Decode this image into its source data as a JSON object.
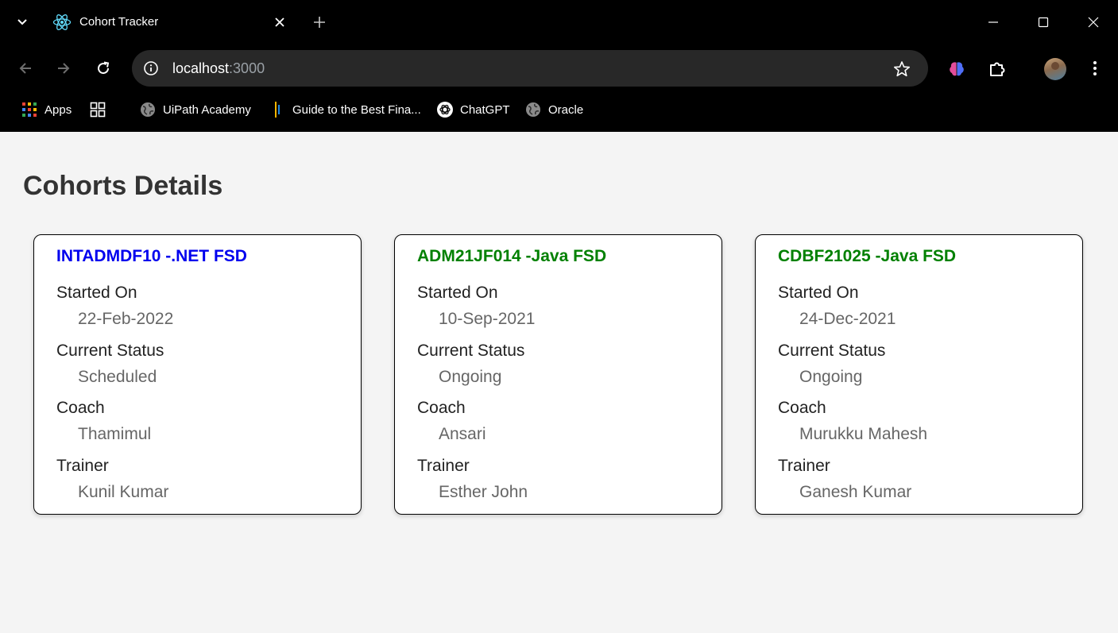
{
  "browser": {
    "tab": {
      "title": "Cohort Tracker",
      "favicon": "react-atom-icon"
    },
    "url": {
      "host": "localhost",
      "port": ":3000"
    },
    "bookmarks": [
      {
        "label": "Apps",
        "icon": "apps-grid-icon"
      },
      {
        "label": "",
        "icon": "tab-groups-icon"
      },
      {
        "label": "UiPath Academy",
        "icon": "globe-icon"
      },
      {
        "label": "Guide to the Best Fina...",
        "icon": "bars-icon"
      },
      {
        "label": "ChatGPT",
        "icon": "chatgpt-icon"
      },
      {
        "label": "Oracle",
        "icon": "globe-icon"
      }
    ]
  },
  "page": {
    "title": "Cohorts Details",
    "cohorts": [
      {
        "heading": "INTADMDF10 -.NET FSD",
        "heading_color": "#0000ee",
        "started_on_label": "Started On",
        "started_on": "22-Feb-2022",
        "status_label": "Current Status",
        "status": "Scheduled",
        "coach_label": "Coach",
        "coach": "Thamimul",
        "trainer_label": "Trainer",
        "trainer": "Kunil Kumar"
      },
      {
        "heading": "ADM21JF014 -Java FSD",
        "heading_color": "#008000",
        "started_on_label": "Started On",
        "started_on": "10-Sep-2021",
        "status_label": "Current Status",
        "status": "Ongoing",
        "coach_label": "Coach",
        "coach": "Ansari",
        "trainer_label": "Trainer",
        "trainer": "Esther John"
      },
      {
        "heading": "CDBF21025 -Java FSD",
        "heading_color": "#008000",
        "started_on_label": "Started On",
        "started_on": "24-Dec-2021",
        "status_label": "Current Status",
        "status": "Ongoing",
        "coach_label": "Coach",
        "coach": "Murukku Mahesh",
        "trainer_label": "Trainer",
        "trainer": "Ganesh Kumar"
      }
    ]
  }
}
